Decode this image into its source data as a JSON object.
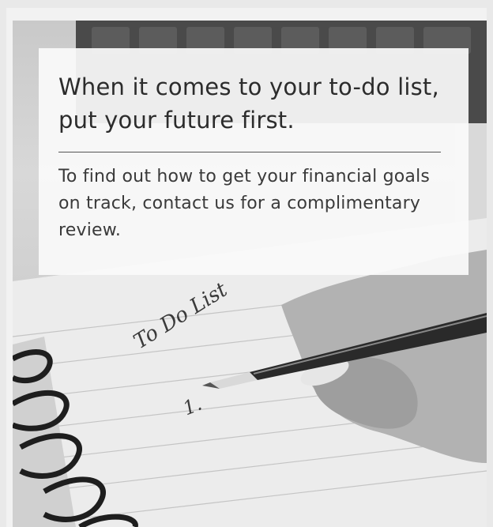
{
  "ad": {
    "headline": "When it comes to your to-do list, put your future first.",
    "body": "To find out how to get your financial goals on track, contact us for a complimentary review."
  },
  "photo": {
    "handwritten_title": "To Do List",
    "handwritten_item": "1."
  }
}
